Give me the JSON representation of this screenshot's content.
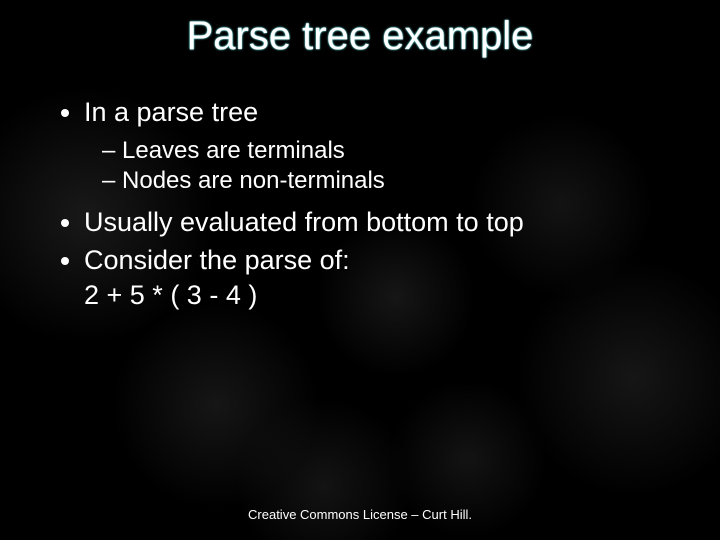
{
  "title": "Parse tree example",
  "bullets": {
    "b1": "In a parse tree",
    "b1_subs": {
      "s1": "Leaves are terminals",
      "s2": "Nodes are non-terminals"
    },
    "b2": "Usually evaluated from bottom to top",
    "b3": "Consider the parse of:",
    "b3_expr": "2 + 5 * ( 3 - 4 )"
  },
  "footer": "Creative Commons License – Curt Hill."
}
